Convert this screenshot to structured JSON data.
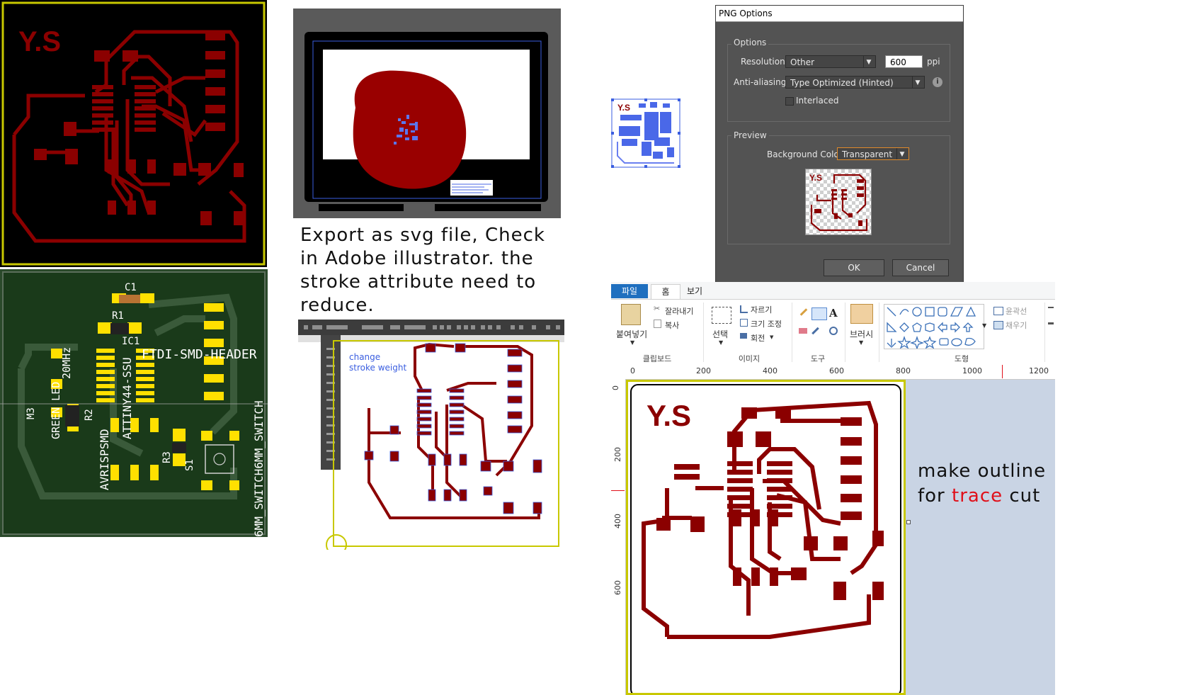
{
  "board_logo": "Y.S",
  "eagle": {
    "labels": {
      "c1": "C1",
      "r1": "R1",
      "ic1": "IC1",
      "ic1_val": "ATTINY44-SSU",
      "ftdi": "FTDI-SMD-HEADER",
      "mhz": "20MHz",
      "green_led": "GREEN LED",
      "m3": "M3",
      "r2": "R2",
      "r3": "R3",
      "s1": "S1",
      "avrisp": "AVRISPSMD",
      "switch": "6MM_SWITCH6MM_SWITCH"
    }
  },
  "notes": {
    "export": [
      "Export as svg file,  Check",
      "in Adobe illustrator. the",
      "stroke attribute need to",
      "reduce."
    ],
    "change_stroke": [
      "change",
      "stroke weight"
    ],
    "outline_prefix": "make outline",
    "outline_for": "for",
    "outline_trace": "trace",
    "outline_cut": "cut"
  },
  "png_dialog": {
    "title": "PNG Options",
    "options_group": "Options",
    "resolution_label": "Resolution:",
    "resolution_value": "Other",
    "ppi_value": "600",
    "ppi_unit": "ppi",
    "antialias_label": "Anti-aliasing:",
    "antialias_value": "Type Optimized (Hinted)",
    "interlaced_label": "Interlaced",
    "interlaced_checked": false,
    "preview_group": "Preview",
    "bg_color_label": "Background Color:",
    "bg_color_value": "Transparent",
    "ok_label": "OK",
    "cancel_label": "Cancel"
  },
  "paint": {
    "tabs": [
      "파일",
      "홈",
      "보기"
    ],
    "clipboard": {
      "paste": "붙여넣기",
      "cut": "잘라내기",
      "copy": "복사",
      "group": "클립보드"
    },
    "image": {
      "select": "선택",
      "crop": "자르기",
      "resize": "크기 조정",
      "rotate": "회전",
      "group": "이미지"
    },
    "tools": {
      "group": "도구"
    },
    "brushes": {
      "label": "브러시"
    },
    "shapes": {
      "outline": "윤곽선",
      "fill": "채우기",
      "group": "도형"
    },
    "ruler_h": [
      "0",
      "200",
      "400",
      "600",
      "800",
      "1000",
      "1200"
    ],
    "ruler_v": [
      "0",
      "200",
      "400",
      "600"
    ]
  },
  "colors": {
    "trace": "#8b0000",
    "eagle_bg": "#000000",
    "board_border": "#c8c800",
    "pad_yellow": "#ffe000",
    "board_green": "#2b4a2b",
    "dialog_bg": "#535353",
    "paint_blue": "#1f6fbf",
    "highlight_red": "#e0101a"
  }
}
